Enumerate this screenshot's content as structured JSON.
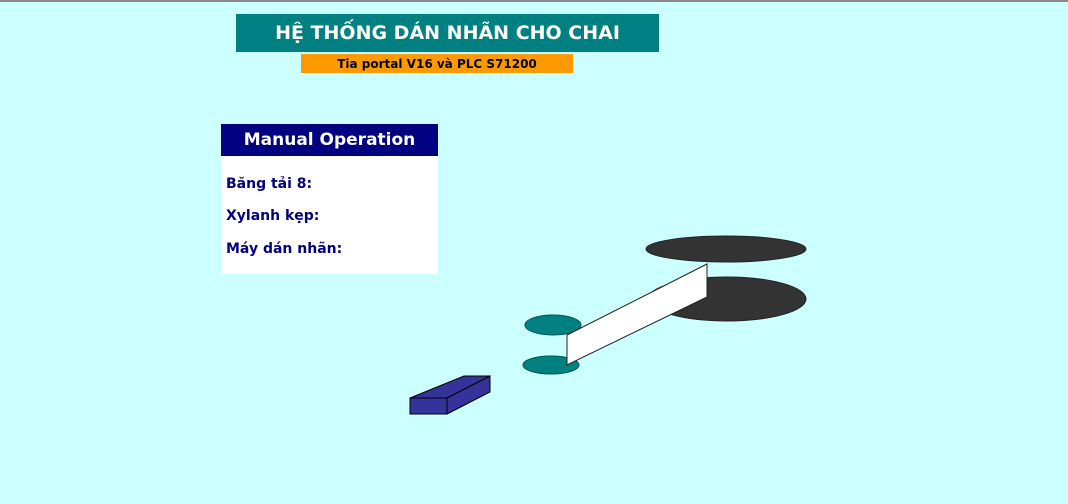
{
  "header": {
    "title": "HỆ THỐNG DÁN NHÃN CHO CHAI",
    "subtitle": "Tia portal V16 và PLC S71200"
  },
  "manual_panel": {
    "title": "Manual Operation",
    "items": [
      {
        "label": "Băng tải 8:"
      },
      {
        "label": "Xylanh kẹp:"
      },
      {
        "label": "Máy dán nhãn:"
      }
    ]
  },
  "colors": {
    "background": "#ccffff",
    "title_bg": "#008080",
    "subtitle_bg": "#ff9900",
    "panel_head": "#000080",
    "roll": "#333333",
    "clamp": "#008080",
    "conveyor": "#333399"
  }
}
